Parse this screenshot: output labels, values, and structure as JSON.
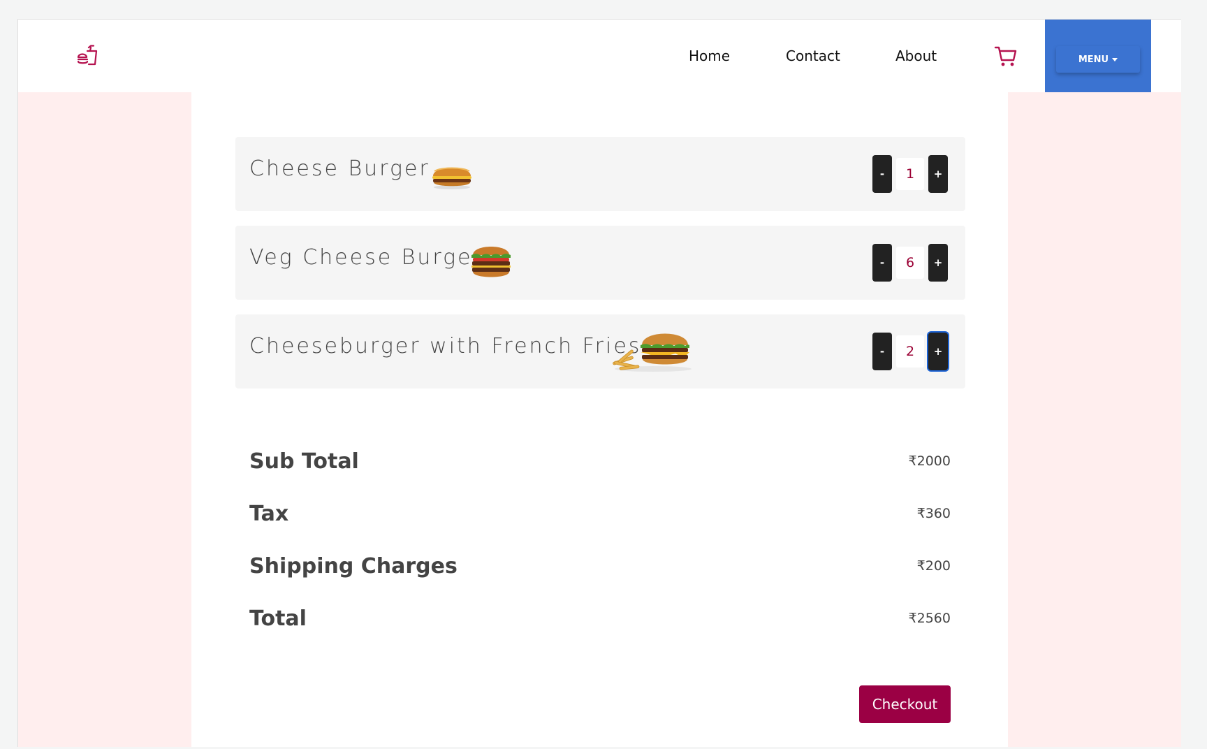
{
  "navbar": {
    "logo_icon": "fast-food-icon",
    "links": [
      "Home",
      "Contact",
      "About"
    ],
    "cart_icon": "shopping-cart-icon",
    "menu_label": "MENU",
    "brand_color": "#9b0044",
    "menu_color": "#3b73d1"
  },
  "cart": {
    "items": [
      {
        "name": "Cheese Burger",
        "image": "cheese-burger-image",
        "quantity": "1",
        "minus": "-",
        "plus": "+"
      },
      {
        "name": "Veg Cheese Burger",
        "image": "veg-cheese-burger-image",
        "quantity": "6",
        "minus": "-",
        "plus": "+"
      },
      {
        "name": "Cheeseburger with French Fries",
        "image": "cheeseburger-fries-image",
        "quantity": "2",
        "minus": "-",
        "plus": "+"
      }
    ]
  },
  "summary": {
    "subtotal_label": "Sub Total",
    "subtotal_value": "₹2000",
    "tax_label": "Tax",
    "tax_value": "₹360",
    "shipping_label": "Shipping Charges",
    "shipping_value": "₹200",
    "total_label": "Total",
    "total_value": "₹2560"
  },
  "checkout_label": "Checkout"
}
